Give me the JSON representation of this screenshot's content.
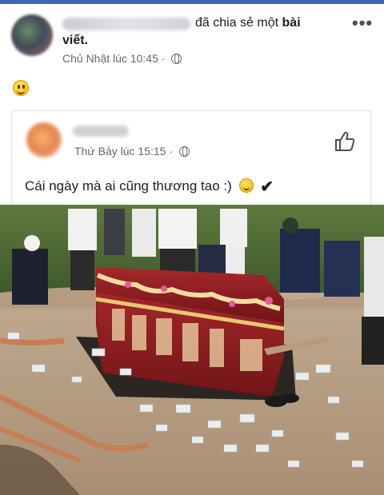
{
  "post": {
    "share_action": "đã chia sẻ một",
    "share_object_line1": "bài",
    "share_object_line2": "viết.",
    "timestamp": "Chủ Nhật lúc 10:45 ·",
    "more_label": "•••"
  },
  "shared_post": {
    "timestamp": "Thứ Bảy lúc 15:15 ·",
    "caption": "Cái ngày mà ai cũng thương tao :)",
    "check_mark": "✔"
  },
  "colors": {
    "brand": "#4267b2",
    "secondary_text": "#65676b",
    "card_border": "#dddfe2"
  },
  "icons": [
    "globe-icon",
    "more-options-icon",
    "smiley-emoji",
    "like-icon",
    "blush-emoji",
    "check-icon"
  ]
}
